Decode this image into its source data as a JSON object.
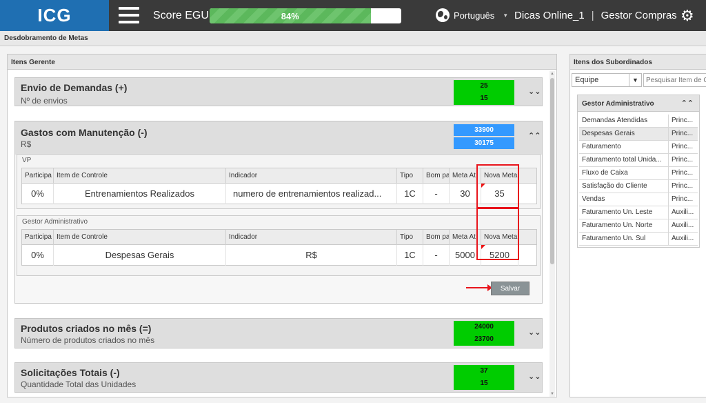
{
  "header": {
    "logo": "ICG",
    "score_label": "Score EGU:",
    "score_value": "84%",
    "score_progress": 0.84,
    "language": "Português",
    "user": "Dicas Online_1",
    "separator": "|",
    "role": "Gestor Compras"
  },
  "breadcrumb": "Desdobramento de Metas",
  "left_panel": {
    "title": "Itens Gerente",
    "goals": [
      {
        "title": "Envio de Demandas (+)",
        "unit": "Nº de envios",
        "value1": "25",
        "value2": "15"
      },
      {
        "title": "Gastos com Manutenção (-)",
        "unit": "R$",
        "value1": "33900",
        "value2": "30175"
      },
      {
        "title": "Produtos criados no mês (=)",
        "unit": "Número de produtos criados no mês",
        "value1": "24000",
        "value2": "23700"
      },
      {
        "title": "Solicitações Totais (-)",
        "unit": "Quantidade Total das Unidades",
        "value1": "37",
        "value2": "15"
      }
    ],
    "columns": [
      "Participa",
      "Item de Controle",
      "Indicador",
      "Tipo",
      "Bom pa",
      "Meta At",
      "Nova Meta"
    ],
    "sections": [
      {
        "label": "VP",
        "row": {
          "participa": "0%",
          "item": "Entrenamientos Realizados",
          "indicador": "numero de entrenamientos realizad...",
          "tipo": "1C",
          "bom": "-",
          "meta": "30",
          "nova": "35"
        }
      },
      {
        "label": "Gestor Administrativo",
        "row": {
          "participa": "0%",
          "item": "Despesas Gerais",
          "indicador": "R$",
          "tipo": "1C",
          "bom": "-",
          "meta": "5000",
          "nova": "5200"
        }
      }
    ],
    "save_label": "Salvar"
  },
  "right_panel": {
    "title": "Itens dos Subordinados",
    "filter_value": "Equipe",
    "search_placeholder": "Pesquisar Item de Co",
    "group_title": "Gestor Administrativo",
    "items": [
      {
        "name": "Demandas Atendidas",
        "type": "Princ..."
      },
      {
        "name": "Despesas Gerais",
        "type": "Princ..."
      },
      {
        "name": "Faturamento",
        "type": "Princ..."
      },
      {
        "name": "Faturamento total Unida...",
        "type": "Princ..."
      },
      {
        "name": "Fluxo de Caixa",
        "type": "Princ..."
      },
      {
        "name": "Satisfação do Cliente",
        "type": "Princ..."
      },
      {
        "name": "Vendas",
        "type": "Princ..."
      },
      {
        "name": "Faturamento Un. Leste",
        "type": "Auxili..."
      },
      {
        "name": "Faturamento Un. Norte",
        "type": "Auxili..."
      },
      {
        "name": "Faturamento Un. Sul",
        "type": "Auxili..."
      }
    ]
  },
  "colors": {
    "brand": "#1f6fb2",
    "topbar": "#3a3a3a",
    "green": "#00cc00",
    "blue": "#3399ff",
    "highlight": "#e8141c"
  }
}
